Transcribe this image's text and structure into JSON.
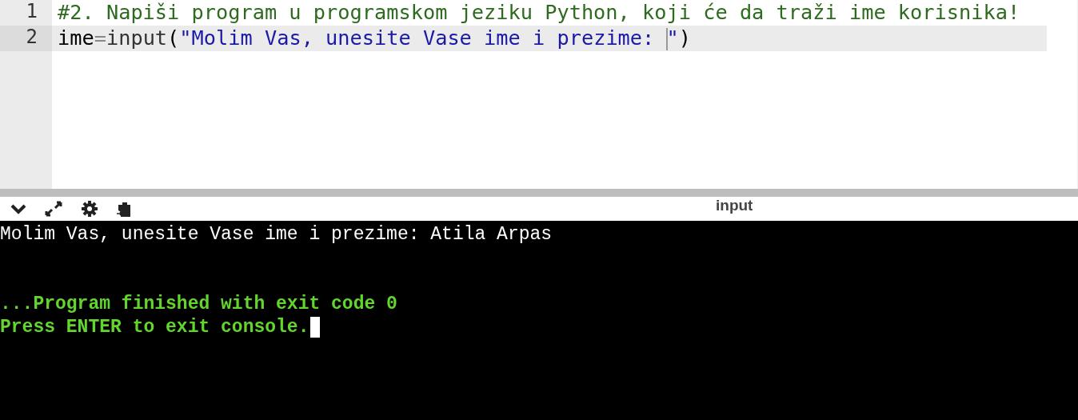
{
  "editor": {
    "lines": [
      {
        "number": "1",
        "active": false,
        "tokens": [
          {
            "kind": "comment",
            "text": "#2. Napiši program u programskom jeziku Python, koji će da traži ime korisnika!"
          }
        ]
      },
      {
        "number": "2",
        "active": true,
        "tokens": [
          {
            "kind": "variable",
            "text": "ime"
          },
          {
            "kind": "operator",
            "text": "="
          },
          {
            "kind": "builtin",
            "text": "input"
          },
          {
            "kind": "punctuation",
            "text": "("
          },
          {
            "kind": "string",
            "text": "\"Molim Vas, unesite Vase ime i prezime: "
          },
          {
            "kind": "cursor"
          },
          {
            "kind": "string",
            "text": "\""
          },
          {
            "kind": "punctuation",
            "text": ")"
          }
        ]
      }
    ]
  },
  "toolbar": {
    "title": "input"
  },
  "console": {
    "lines": [
      {
        "kind": "output",
        "text": "Molim Vas, unesite Vase ime i prezime: Atila Arpas"
      },
      {
        "kind": "blank"
      },
      {
        "kind": "blank"
      },
      {
        "kind": "status",
        "text": "...Program finished with exit code 0"
      },
      {
        "kind": "status",
        "text": "Press ENTER to exit console.",
        "cursor": true
      }
    ]
  }
}
